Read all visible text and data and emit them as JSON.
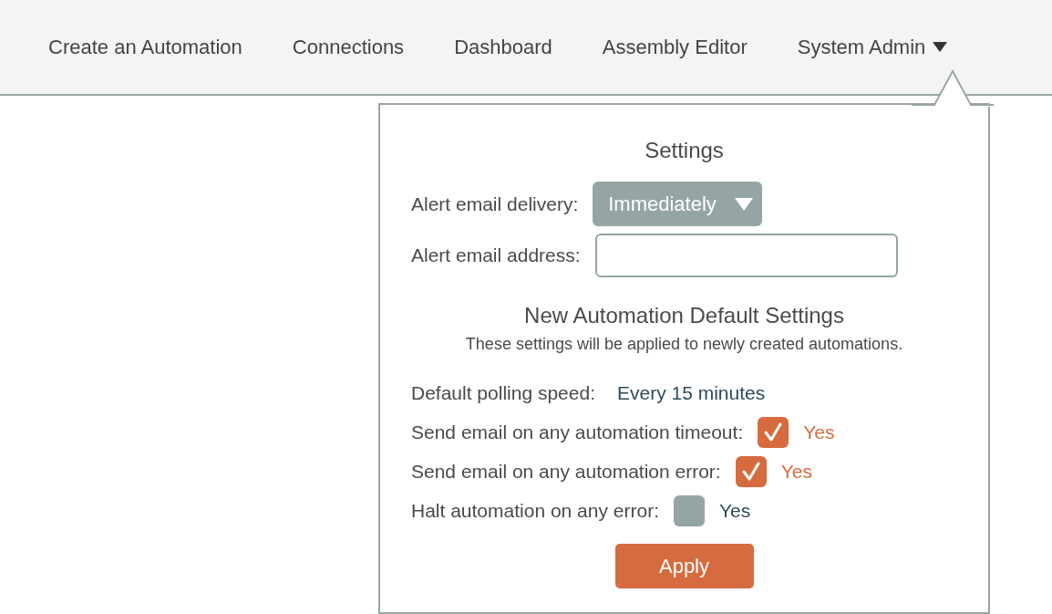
{
  "nav": {
    "items": [
      {
        "label": "Create an Automation",
        "has_menu": false
      },
      {
        "label": "Connections",
        "has_menu": false
      },
      {
        "label": "Dashboard",
        "has_menu": false
      },
      {
        "label": "Assembly Editor",
        "has_menu": false
      },
      {
        "label": "System Admin",
        "has_menu": true
      }
    ]
  },
  "settings": {
    "title": "Settings",
    "delivery": {
      "label": "Alert email delivery:",
      "value": "Immediately"
    },
    "address": {
      "label": "Alert email address:"
    },
    "defaults_title": "New Automation Default Settings",
    "defaults_note": "These settings will be applied to newly created automations.",
    "polling": {
      "label": "Default polling speed:",
      "value": "Every 15 minutes"
    },
    "options": [
      {
        "label": "Send email on any automation timeout:",
        "checked": true,
        "text": "Yes"
      },
      {
        "label": "Send email on any automation error:",
        "checked": true,
        "text": "Yes"
      },
      {
        "label": "Halt automation on any error:",
        "checked": false,
        "text": "Yes"
      }
    ],
    "apply": "Apply"
  }
}
